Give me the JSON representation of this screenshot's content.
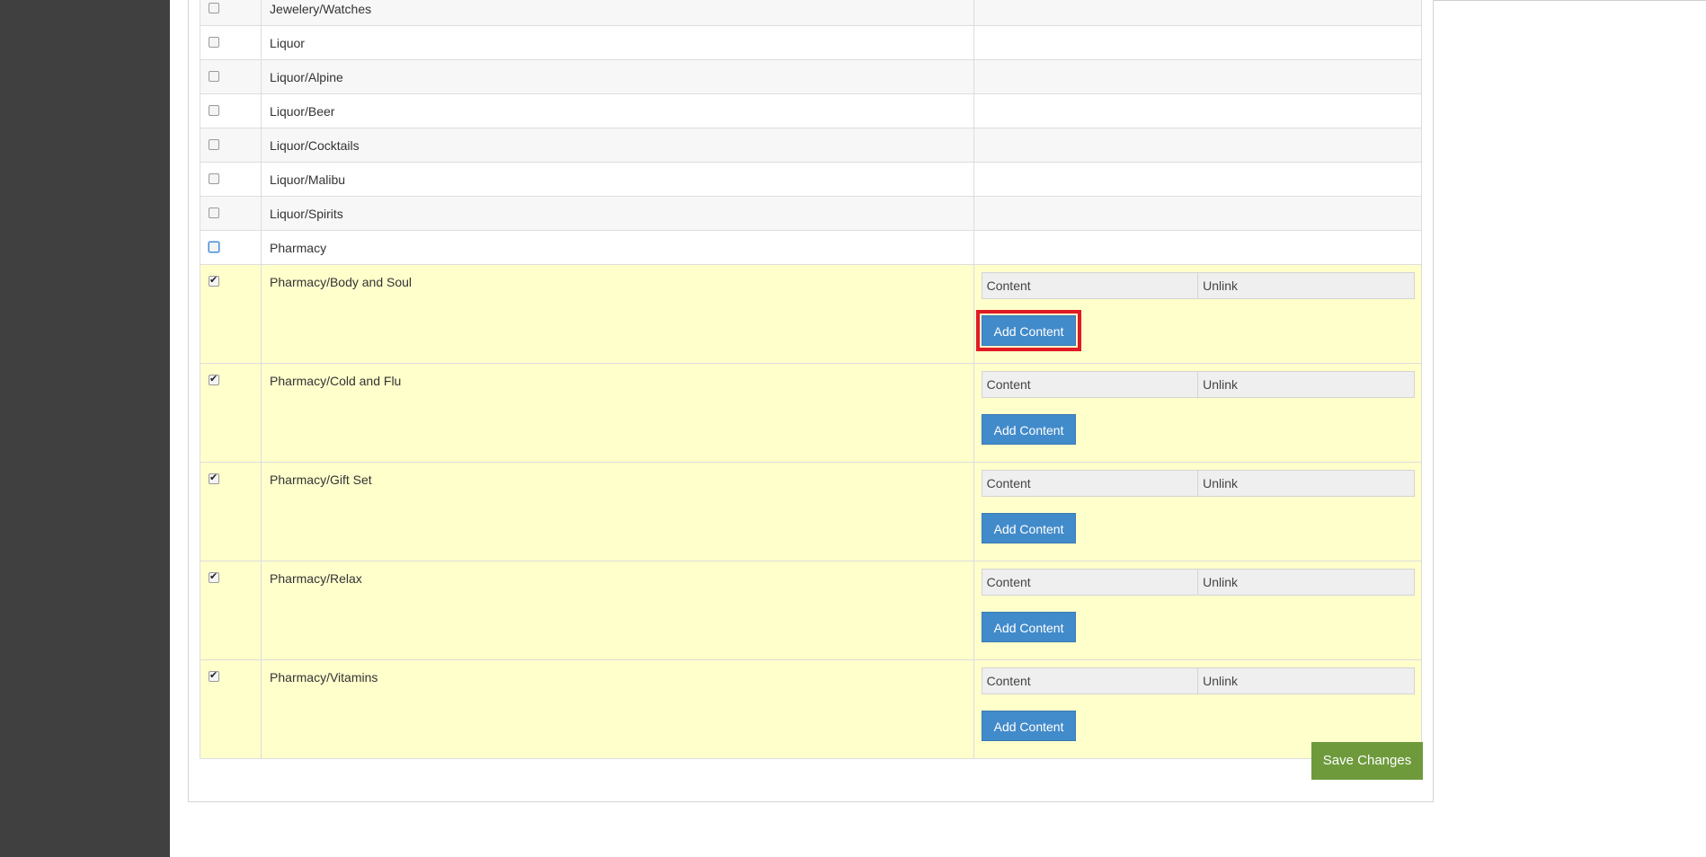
{
  "categories": [
    {
      "name": "Jewelery/Watches",
      "checked": false
    },
    {
      "name": "Liquor",
      "checked": false
    },
    {
      "name": "Liquor/Alpine",
      "checked": false
    },
    {
      "name": "Liquor/Beer",
      "checked": false
    },
    {
      "name": "Liquor/Cocktails",
      "checked": false
    },
    {
      "name": "Liquor/Malibu",
      "checked": false
    },
    {
      "name": "Liquor/Spirits",
      "checked": false
    },
    {
      "name": "Pharmacy",
      "checked": false
    },
    {
      "name": "Pharmacy/Body and Soul",
      "checked": true
    },
    {
      "name": "Pharmacy/Cold and Flu",
      "checked": true
    },
    {
      "name": "Pharmacy/Gift Set",
      "checked": true
    },
    {
      "name": "Pharmacy/Relax",
      "checked": true
    },
    {
      "name": "Pharmacy/Vitamins",
      "checked": true
    }
  ],
  "content_table": {
    "col_content": "Content",
    "col_unlink": "Unlink",
    "add_label": "Add Content"
  },
  "save_label": "Save Changes",
  "colors": {
    "sidebar": "#404040",
    "linked_row": "#ffffcc",
    "add_button": "#428bca",
    "save_button": "#6e9a3c",
    "highlight": "#e01b24"
  }
}
